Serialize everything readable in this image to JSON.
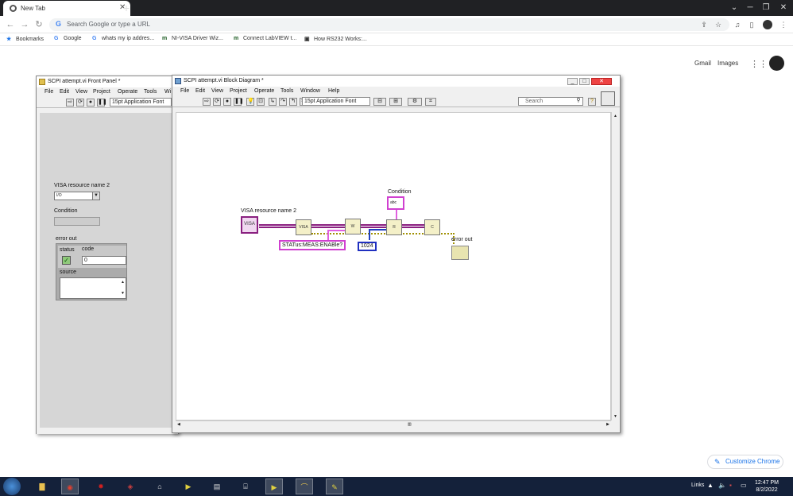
{
  "browser": {
    "tab_title": "New Tab",
    "tab_close": "✕",
    "new_tab": "+",
    "omnibox_placeholder": "Search Google or type a URL",
    "bookmarks": [
      {
        "label": "Bookmarks",
        "icon": "star-icon"
      },
      {
        "label": "Google",
        "icon": "google-icon"
      },
      {
        "label": "whats my ip addres...",
        "icon": "google-icon"
      },
      {
        "label": "NI-VISA Driver Wiz...",
        "icon": "ni-icon"
      },
      {
        "label": "Connect LabVIEW t...",
        "icon": "ni-icon"
      },
      {
        "label": "How RS232 Works:...",
        "icon": "rs232-icon"
      }
    ],
    "gmail": "Gmail",
    "images": "Images",
    "customize": "Customize Chrome"
  },
  "front_panel": {
    "title": "SCPI attempt.vi Front Panel *",
    "menu": [
      "File",
      "Edit",
      "View",
      "Project",
      "Operate",
      "Tools",
      "Wi"
    ],
    "font": "15pt Application Font",
    "visa_label": "VISA resource name 2",
    "visa_value": "I/O",
    "condition_label": "Condition",
    "error_out_label": "error out",
    "status_label": "status",
    "code_label": "code",
    "code_value": "0",
    "source_label": "source",
    "status_glyph": "✓"
  },
  "block_diagram": {
    "title": "SCPI attempt.vi Block Diagram *",
    "menu": [
      "File",
      "Edit",
      "View",
      "Project",
      "Operate",
      "Tools",
      "Window",
      "Help"
    ],
    "font": "15pt Application Font",
    "search_placeholder": "Search",
    "visa_label": "VISA resource name 2",
    "visa_icon": "VISA",
    "condition_label": "Condition",
    "condition_indicator": "abc",
    "error_out_label": "error out",
    "command_string": "STATus:MEAS:ENABle?",
    "byte_count": "1024",
    "node_open": "VISA",
    "node_write": "W",
    "node_read": "R",
    "node_close": "C"
  },
  "taskbar": {
    "links": "Links",
    "time": "12:47 PM",
    "date": "8/2/2022",
    "apps": [
      "explorer-icon",
      "chrome-icon",
      "app-icon",
      "app-icon",
      "term-icon",
      "labview-icon",
      "app-icon",
      "app-icon",
      "labview-icon",
      "labview-icon",
      "app-icon"
    ]
  }
}
